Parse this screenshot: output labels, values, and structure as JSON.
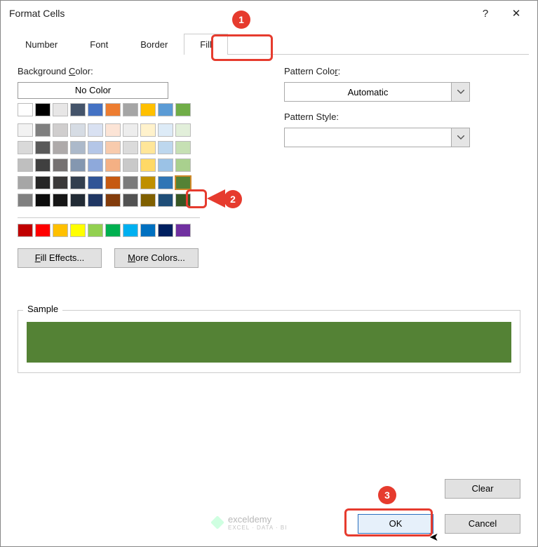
{
  "title": "Format Cells",
  "titlebar": {
    "help": "?",
    "close": "✕"
  },
  "tabs": [
    {
      "label": "Number"
    },
    {
      "label": "Font"
    },
    {
      "label": "Border"
    },
    {
      "label": "Fill",
      "active": true
    }
  ],
  "labels": {
    "bgcolor_pre": "Background ",
    "bgcolor_u": "C",
    "bgcolor_post": "olor:",
    "nocolor": "No Color",
    "filleffects_u": "F",
    "filleffects_post": "ill Effects...",
    "morecolors_u": "M",
    "morecolors_post": "ore Colors...",
    "patterncolor_pre": "Pattern Colo",
    "patterncolor_u": "r",
    "patterncolor_post": ":",
    "patternstyle": "Pattern Style:",
    "sample": "Sample",
    "clear": "Clear",
    "ok": "OK",
    "cancel": "Cancel"
  },
  "patternColor": "Automatic",
  "themeRow": [
    "#ffffff",
    "#000000",
    "#e7e6e6",
    "#44546a",
    "#4472c4",
    "#ed7d31",
    "#a5a5a5",
    "#ffc000",
    "#5b9bd5",
    "#70ad47"
  ],
  "palette": [
    [
      "#f2f2f2",
      "#7f7f7f",
      "#d0cece",
      "#d6dce4",
      "#d9e1f2",
      "#fce4d6",
      "#ededed",
      "#fff2cc",
      "#ddebf7",
      "#e2efda"
    ],
    [
      "#d9d9d9",
      "#595959",
      "#aeaaaa",
      "#acb9ca",
      "#b4c6e7",
      "#f8cbad",
      "#dbdbdb",
      "#ffe699",
      "#bdd7ee",
      "#c6e0b4"
    ],
    [
      "#bfbfbf",
      "#404040",
      "#757171",
      "#8497b0",
      "#8ea9db",
      "#f4b084",
      "#c9c9c9",
      "#ffd966",
      "#9bc2e6",
      "#a9d08e"
    ],
    [
      "#a6a6a6",
      "#262626",
      "#3a3838",
      "#333f4f",
      "#305496",
      "#c65911",
      "#7b7b7b",
      "#bf8f00",
      "#2f75b5",
      "#548235"
    ],
    [
      "#808080",
      "#0d0d0d",
      "#161616",
      "#222b35",
      "#203764",
      "#833c0c",
      "#525252",
      "#806000",
      "#1f4e78",
      "#375623"
    ]
  ],
  "standard": [
    "#c00000",
    "#ff0000",
    "#ffc000",
    "#ffff00",
    "#92d050",
    "#00b050",
    "#00b0f0",
    "#0070c0",
    "#002060",
    "#7030a0"
  ],
  "selectedColor": "#548235",
  "annotations": {
    "b1": "1",
    "b2": "2",
    "b3": "3"
  },
  "watermark": {
    "name": "exceldemy",
    "sub": "EXCEL · DATA · BI"
  }
}
